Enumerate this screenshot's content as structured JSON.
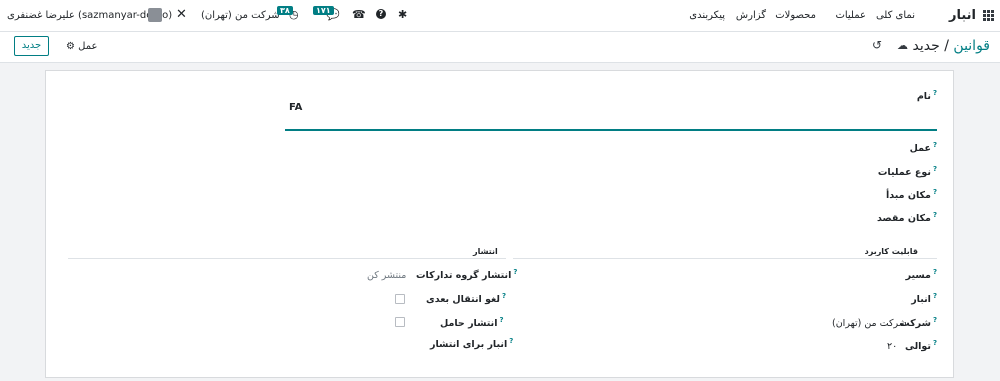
{
  "navbar": {
    "app_name": "انبار",
    "menu": [
      "نمای کلی",
      "عملیات",
      "محصولات",
      "گزارش",
      "پیکربندی"
    ],
    "activity_count": "۳۸",
    "messages_count": "۱۷۱",
    "company": "شرکت من (تهران)",
    "user": "علیرضا غضنفری (sazmanyar-demo)"
  },
  "control": {
    "breadcrumb_parent": "قوانین",
    "breadcrumb_sep": "/",
    "breadcrumb_current": "جدید",
    "new_button": "جدید",
    "action_label": "عمل"
  },
  "form": {
    "name_label": "نام",
    "name_value": "FA",
    "action_label": "عمل",
    "picking_type_label": "نوع عملیات",
    "src_location_label": "مکان مبدأ",
    "dest_location_label": "مکان مقصد",
    "applicability_title": "قابلیت کاربرد",
    "route_label": "مسیر",
    "warehouse_label": "انبار",
    "company_label": "شرکت",
    "company_value": "شرکت من (تهران)",
    "sequence_label": "توالی",
    "sequence_value": "۲۰",
    "propagation_title": "انتشار",
    "group_label": "انتشار گروه تدارکات",
    "group_value": "منتشر کن",
    "cancel_label": "لغو انتقال بعدی",
    "carrier_label": "انتشار حامل",
    "warehouse_prop_label": "انبار برای انتشار"
  },
  "colors": {
    "accent": "#017e84",
    "brand_text": "#714b67"
  }
}
